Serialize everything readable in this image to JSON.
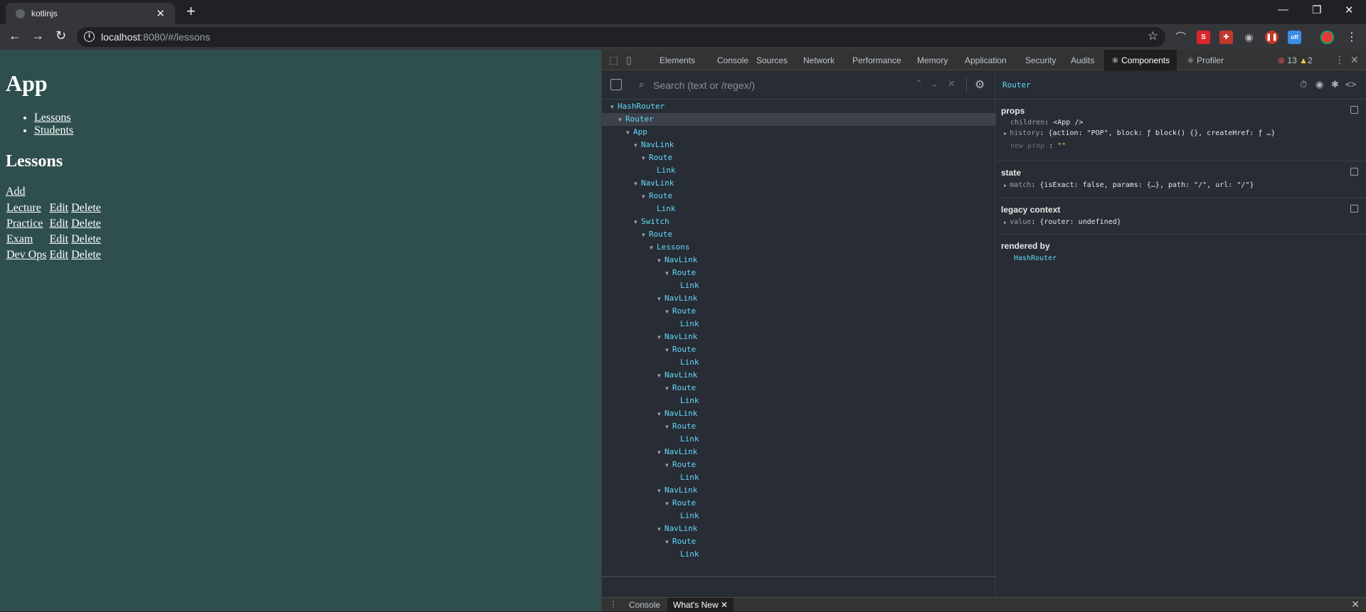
{
  "browser": {
    "tab_title": "kotlinjs",
    "url_host": "localhost",
    "url_rest": ":8080/#/lessons"
  },
  "page": {
    "heading": "App",
    "nav": [
      "Lessons",
      "Students"
    ],
    "section_heading": "Lessons",
    "add_label": "Add",
    "rows": [
      {
        "name": "Lecture",
        "edit": "Edit",
        "delete": "Delete"
      },
      {
        "name": "Practice",
        "edit": "Edit",
        "delete": "Delete"
      },
      {
        "name": "Exam",
        "edit": "Edit",
        "delete": "Delete"
      },
      {
        "name": "Dev Ops",
        "edit": "Edit",
        "delete": "Delete"
      }
    ]
  },
  "devtools": {
    "tabs": [
      "Elements",
      "Console",
      "Sources",
      "Network",
      "Performance",
      "Memory",
      "Application",
      "Security",
      "Audits",
      "⚛ Components",
      "⚛ Profiler"
    ],
    "error_count": "13",
    "warning_count": "2",
    "search_placeholder": "Search (text or /regex/)",
    "tree": [
      {
        "name": "HashRouter",
        "depth": 0
      },
      {
        "name": "Router",
        "depth": 1,
        "selected": true
      },
      {
        "name": "App",
        "depth": 2
      },
      {
        "name": "NavLink",
        "depth": 3
      },
      {
        "name": "Route",
        "depth": 4
      },
      {
        "name": "Link",
        "depth": 5,
        "leaf": true
      },
      {
        "name": "NavLink",
        "depth": 3
      },
      {
        "name": "Route",
        "depth": 4
      },
      {
        "name": "Link",
        "depth": 5,
        "leaf": true
      },
      {
        "name": "Switch",
        "depth": 3
      },
      {
        "name": "Route",
        "depth": 4
      },
      {
        "name": "Lessons",
        "depth": 5
      },
      {
        "name": "NavLink",
        "depth": 6
      },
      {
        "name": "Route",
        "depth": 7
      },
      {
        "name": "Link",
        "depth": 8,
        "leaf": true
      },
      {
        "name": "NavLink",
        "depth": 6
      },
      {
        "name": "Route",
        "depth": 7
      },
      {
        "name": "Link",
        "depth": 8,
        "leaf": true
      },
      {
        "name": "NavLink",
        "depth": 6
      },
      {
        "name": "Route",
        "depth": 7
      },
      {
        "name": "Link",
        "depth": 8,
        "leaf": true
      },
      {
        "name": "NavLink",
        "depth": 6
      },
      {
        "name": "Route",
        "depth": 7
      },
      {
        "name": "Link",
        "depth": 8,
        "leaf": true
      },
      {
        "name": "NavLink",
        "depth": 6
      },
      {
        "name": "Route",
        "depth": 7
      },
      {
        "name": "Link",
        "depth": 8,
        "leaf": true
      },
      {
        "name": "NavLink",
        "depth": 6
      },
      {
        "name": "Route",
        "depth": 7
      },
      {
        "name": "Link",
        "depth": 8,
        "leaf": true
      },
      {
        "name": "NavLink",
        "depth": 6
      },
      {
        "name": "Route",
        "depth": 7
      },
      {
        "name": "Link",
        "depth": 8,
        "leaf": true
      },
      {
        "name": "NavLink",
        "depth": 6
      },
      {
        "name": "Route",
        "depth": 7
      },
      {
        "name": "Link",
        "depth": 8,
        "leaf": true
      }
    ],
    "selected_component": "Router",
    "props_title": "props",
    "props": {
      "children_key": "children",
      "children_val": "<App />",
      "history_key": "history",
      "history_val": "{action: \"POP\", block: ƒ block() {}, createHref: ƒ …}",
      "new_prop_key": "new prop",
      "new_prop_val": "\"\""
    },
    "state_title": "state",
    "state": {
      "match_key": "match",
      "match_val": "{isExact: false, params: {…}, path: \"/\", url: \"/\"}"
    },
    "legacy_title": "legacy context",
    "legacy": {
      "value_key": "value",
      "value_val": "{router: undefined}"
    },
    "rendered_by_title": "rendered by",
    "rendered_by": "HashRouter",
    "drawer_tabs": [
      "Console",
      "What's New"
    ]
  }
}
